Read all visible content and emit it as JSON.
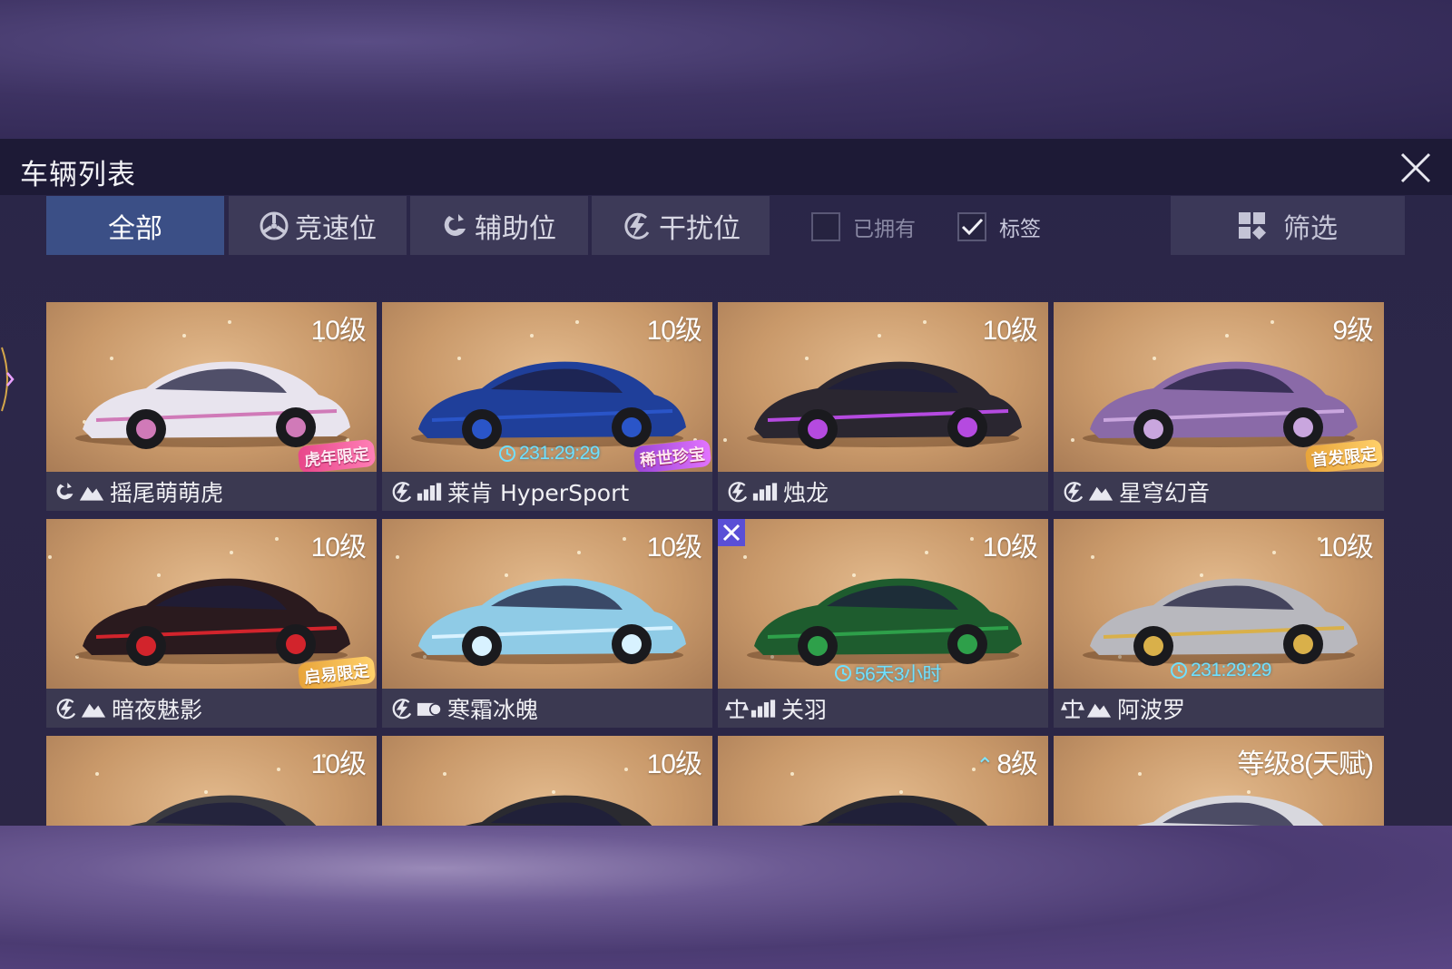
{
  "panel": {
    "title": "车辆列表"
  },
  "tabs": [
    {
      "label": "全部",
      "icon": "none",
      "active": true
    },
    {
      "label": "竞速位",
      "icon": "wheel-icon",
      "active": false
    },
    {
      "label": "辅助位",
      "icon": "support-icon",
      "active": false
    },
    {
      "label": "干扰位",
      "icon": "lightning-icon",
      "active": false
    }
  ],
  "filters": {
    "owned": {
      "label": "已拥有",
      "checked": false
    },
    "tags": {
      "label": "标签",
      "checked": true
    },
    "filter_button": "筛选"
  },
  "colors": {
    "active_tab": "#3b4f86",
    "timer": "#6fe0ff",
    "card_bg": "#c9996a"
  },
  "cars": [
    {
      "name": "摇尾萌萌虎",
      "level": "10级",
      "icons": [
        "support-icon",
        "mountain-icon"
      ],
      "badge": "虎年限定",
      "badge_style": "pink",
      "timer": "",
      "car_color": "#e8e4ee",
      "accent": "#d07ab8"
    },
    {
      "name": "莱肯 HyperSport",
      "level": "10级",
      "icons": [
        "lightning-icon",
        "speed-bars-icon"
      ],
      "badge": "稀世珍宝",
      "badge_style": "purple",
      "timer": "231:29:29",
      "car_color": "#1f3f9a",
      "accent": "#2a55c8"
    },
    {
      "name": "烛龙",
      "level": "10级",
      "icons": [
        "lightning-icon",
        "speed-bars-icon"
      ],
      "badge": "",
      "badge_style": "",
      "timer": "",
      "car_color": "#2a2630",
      "accent": "#b54ae0"
    },
    {
      "name": "星穹幻音",
      "level": "9级",
      "icons": [
        "lightning-icon",
        "mountain-icon"
      ],
      "badge": "首发限定",
      "badge_style": "gold",
      "timer": "",
      "car_color": "#8a6aa8",
      "accent": "#c9a6de"
    },
    {
      "name": "暗夜魅影",
      "level": "10级",
      "icons": [
        "lightning-icon",
        "mountain-icon"
      ],
      "badge": "启易限定",
      "badge_style": "gold",
      "timer": "",
      "car_color": "#2a1a1e",
      "accent": "#d2242c"
    },
    {
      "name": "寒霜冰魄",
      "level": "10级",
      "icons": [
        "lightning-icon",
        "engine-icon"
      ],
      "badge": "",
      "badge_style": "",
      "timer": "",
      "car_color": "#8fcbe6",
      "accent": "#d8f2ff"
    },
    {
      "name": "关羽",
      "level": "10级",
      "icons": [
        "balance-icon",
        "speed-bars-icon"
      ],
      "badge": "",
      "badge_style": "",
      "timer": "56天3小时",
      "car_color": "#1e5c2e",
      "accent": "#2ea04a",
      "tool": true
    },
    {
      "name": "阿波罗",
      "level": "10级",
      "icons": [
        "balance-icon",
        "mountain-icon"
      ],
      "badge": "",
      "badge_style": "",
      "timer": "231:29:29",
      "car_color": "#b8b8be",
      "accent": "#d9b04a"
    },
    {
      "name": "",
      "level": "10级",
      "icons": [],
      "badge": "",
      "badge_style": "",
      "timer": "",
      "car_color": "#3a3a40",
      "accent": "#555"
    },
    {
      "name": "",
      "level": "10级",
      "icons": [],
      "badge": "",
      "badge_style": "",
      "timer": "",
      "car_color": "#2a2a30",
      "accent": "#e07a2a"
    },
    {
      "name": "",
      "level": "8级",
      "level_up": true,
      "icons": [],
      "badge": "",
      "badge_style": "",
      "timer": "",
      "car_color": "#2a2a30",
      "accent": "#7a3ab0"
    },
    {
      "name": "",
      "level": "等级8(天赋)",
      "icons": [],
      "badge": "",
      "badge_style": "",
      "timer": "",
      "car_color": "#d8d8de",
      "accent": "#888"
    }
  ]
}
